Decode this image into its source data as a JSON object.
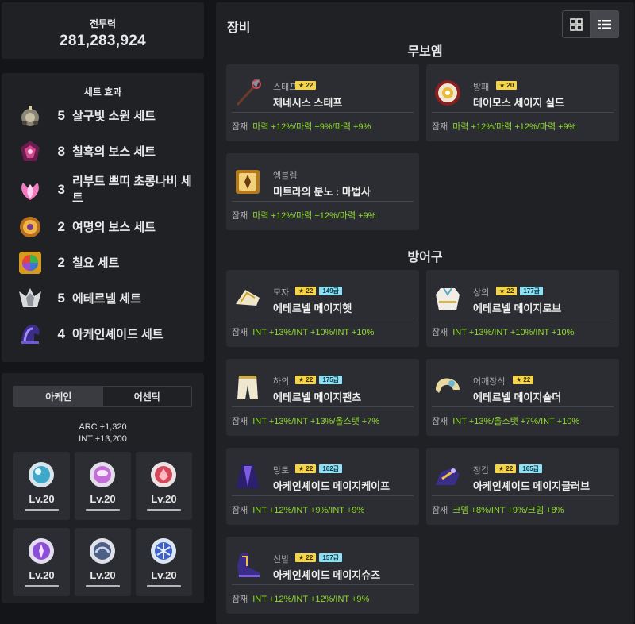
{
  "combat": {
    "label": "전투력",
    "value": "281,283,924"
  },
  "set_effects": {
    "title": "세트 효과",
    "items": [
      {
        "count": "5",
        "name": "살구빛 소원 세트",
        "icon": "apricot-wish-icon"
      },
      {
        "count": "8",
        "name": "칠흑의 보스 세트",
        "icon": "pitch-boss-icon"
      },
      {
        "count": "3",
        "name": "리부트 쁘띠 초롱나비 세트",
        "icon": "petit-butterfly-icon"
      },
      {
        "count": "2",
        "name": "여명의 보스 세트",
        "icon": "dawn-boss-icon"
      },
      {
        "count": "2",
        "name": "칠요 세트",
        "icon": "seven-days-icon"
      },
      {
        "count": "5",
        "name": "에테르넬 세트",
        "icon": "eternal-icon"
      },
      {
        "count": "4",
        "name": "아케인셰이드 세트",
        "icon": "arcane-shade-icon"
      }
    ]
  },
  "symbols": {
    "tabs": [
      "아케인",
      "어센틱"
    ],
    "active_tab": "아케인",
    "stat_arc": "ARC +1,320",
    "stat_int": "INT +13,200",
    "items": [
      {
        "level": "Lv.20",
        "icon": "vanishing-journey-symbol-icon"
      },
      {
        "level": "Lv.20",
        "icon": "chu-chu-island-symbol-icon"
      },
      {
        "level": "Lv.20",
        "icon": "lachelein-symbol-icon"
      },
      {
        "level": "Lv.20",
        "icon": "arcana-symbol-icon"
      },
      {
        "level": "Lv.20",
        "icon": "morass-symbol-icon"
      },
      {
        "level": "Lv.20",
        "icon": "esfera-symbol-icon"
      }
    ]
  },
  "equipment": {
    "title": "장비",
    "view_modes": [
      "grid",
      "list"
    ],
    "weapon_section": {
      "title": "무보엠",
      "items": [
        {
          "type": "스태프",
          "star": "22",
          "grade": "",
          "name": "제네시스 스태프",
          "pot_label": "잠재",
          "pot": "마력 +12%/마력 +9%/마력 +9%",
          "icon": "staff-icon"
        },
        {
          "type": "방패",
          "star": "20",
          "grade": "",
          "name": "데이모스 세이지 실드",
          "pot_label": "잠재",
          "pot": "마력 +12%/마력 +12%/마력 +9%",
          "icon": "shield-icon"
        },
        {
          "type": "엠블렘",
          "star": "",
          "grade": "",
          "name": "미트라의 분노 : 마법사",
          "pot_label": "잠재",
          "pot": "마력 +12%/마력 +12%/마력 +9%",
          "icon": "emblem-icon"
        }
      ]
    },
    "armor_section": {
      "title": "방어구",
      "items": [
        {
          "type": "모자",
          "star": "22",
          "grade": "149급",
          "name": "에테르넬 메이지햇",
          "pot_label": "잠재",
          "pot": "INT +13%/INT +10%/INT +10%",
          "icon": "hat-icon"
        },
        {
          "type": "상의",
          "star": "22",
          "grade": "177급",
          "name": "에테르넬 메이지로브",
          "pot_label": "잠재",
          "pot": "INT +13%/INT +10%/INT +10%",
          "icon": "robe-icon"
        },
        {
          "type": "하의",
          "star": "22",
          "grade": "175급",
          "name": "에테르넬 메이지팬츠",
          "pot_label": "잠재",
          "pot": "INT +13%/INT +13%/올스탯 +7%",
          "icon": "pants-icon"
        },
        {
          "type": "어깨장식",
          "star": "22",
          "grade": "",
          "name": "에테르넬 메이지숄더",
          "pot_label": "잠재",
          "pot": "INT +13%/올스탯 +7%/INT +10%",
          "icon": "shoulder-icon"
        },
        {
          "type": "망토",
          "star": "22",
          "grade": "162급",
          "name": "아케인셰이드 메이지케이프",
          "pot_label": "잠재",
          "pot": "INT +12%/INT +9%/INT +9%",
          "icon": "cape-icon"
        },
        {
          "type": "장갑",
          "star": "22",
          "grade": "165급",
          "name": "아케인셰이드 메이지글러브",
          "pot_label": "잠재",
          "pot": "크뎀 +8%/INT +9%/크뎀 +8%",
          "icon": "glove-icon"
        },
        {
          "type": "신발",
          "star": "22",
          "grade": "157급",
          "name": "아케인셰이드 메이지슈즈",
          "pot_label": "잠재",
          "pot": "INT +12%/INT +12%/INT +9%",
          "icon": "shoes-icon"
        }
      ]
    }
  },
  "colors": {
    "potential": "#8fdc29",
    "star_badge": "#f3d44a",
    "grade_badge": "#8ee0f2",
    "panel": "#202125",
    "card": "#2c2d32"
  }
}
